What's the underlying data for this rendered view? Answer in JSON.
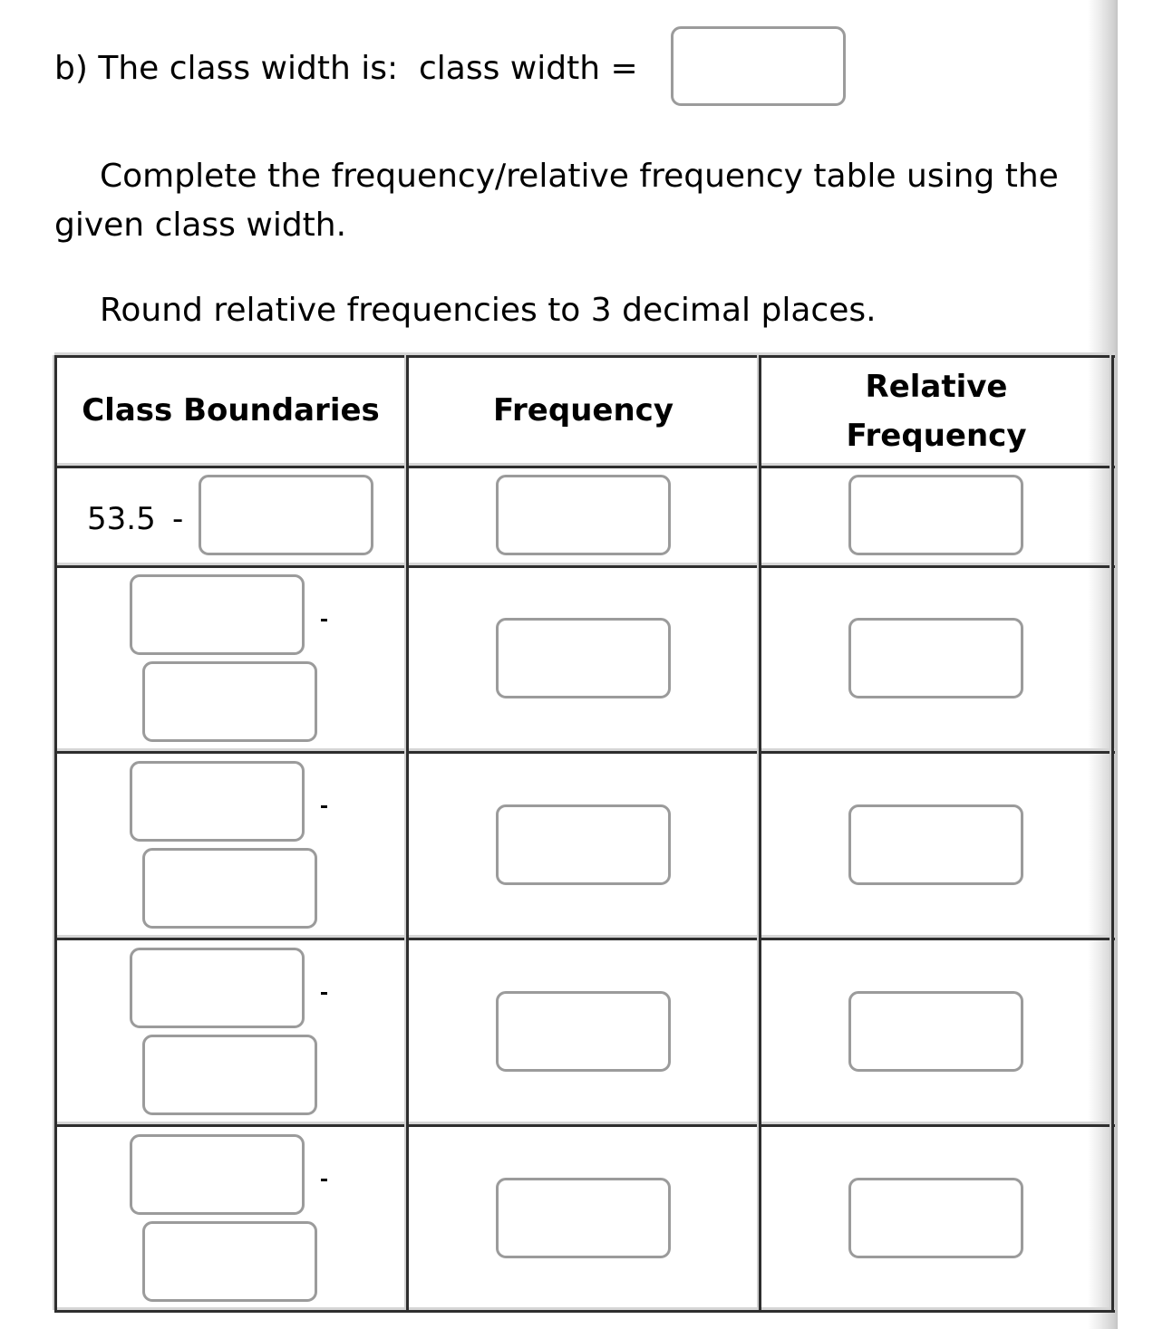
{
  "question": {
    "part_label": "b) The class width is:  class width =",
    "class_width_value": "",
    "instruction": "Complete the frequency/relative frequency table using the given class width.",
    "rounding_note": "Round relative frequencies to 3 decimal places."
  },
  "table": {
    "headers": [
      "Class Boundaries",
      "Frequency",
      "Relative Frequency"
    ],
    "rows": [
      {
        "lower": "53.5",
        "lower_editable": false,
        "separator": "-",
        "upper": "",
        "frequency": "",
        "relative_frequency": ""
      },
      {
        "lower": "",
        "lower_editable": true,
        "separator": "-",
        "upper": "",
        "frequency": "",
        "relative_frequency": ""
      },
      {
        "lower": "",
        "lower_editable": true,
        "separator": "-",
        "upper": "",
        "frequency": "",
        "relative_frequency": ""
      },
      {
        "lower": "",
        "lower_editable": true,
        "separator": "-",
        "upper": "",
        "frequency": "",
        "relative_frequency": ""
      },
      {
        "lower": "",
        "lower_editable": true,
        "separator": "-",
        "upper": "",
        "frequency": "",
        "relative_frequency": ""
      }
    ]
  }
}
